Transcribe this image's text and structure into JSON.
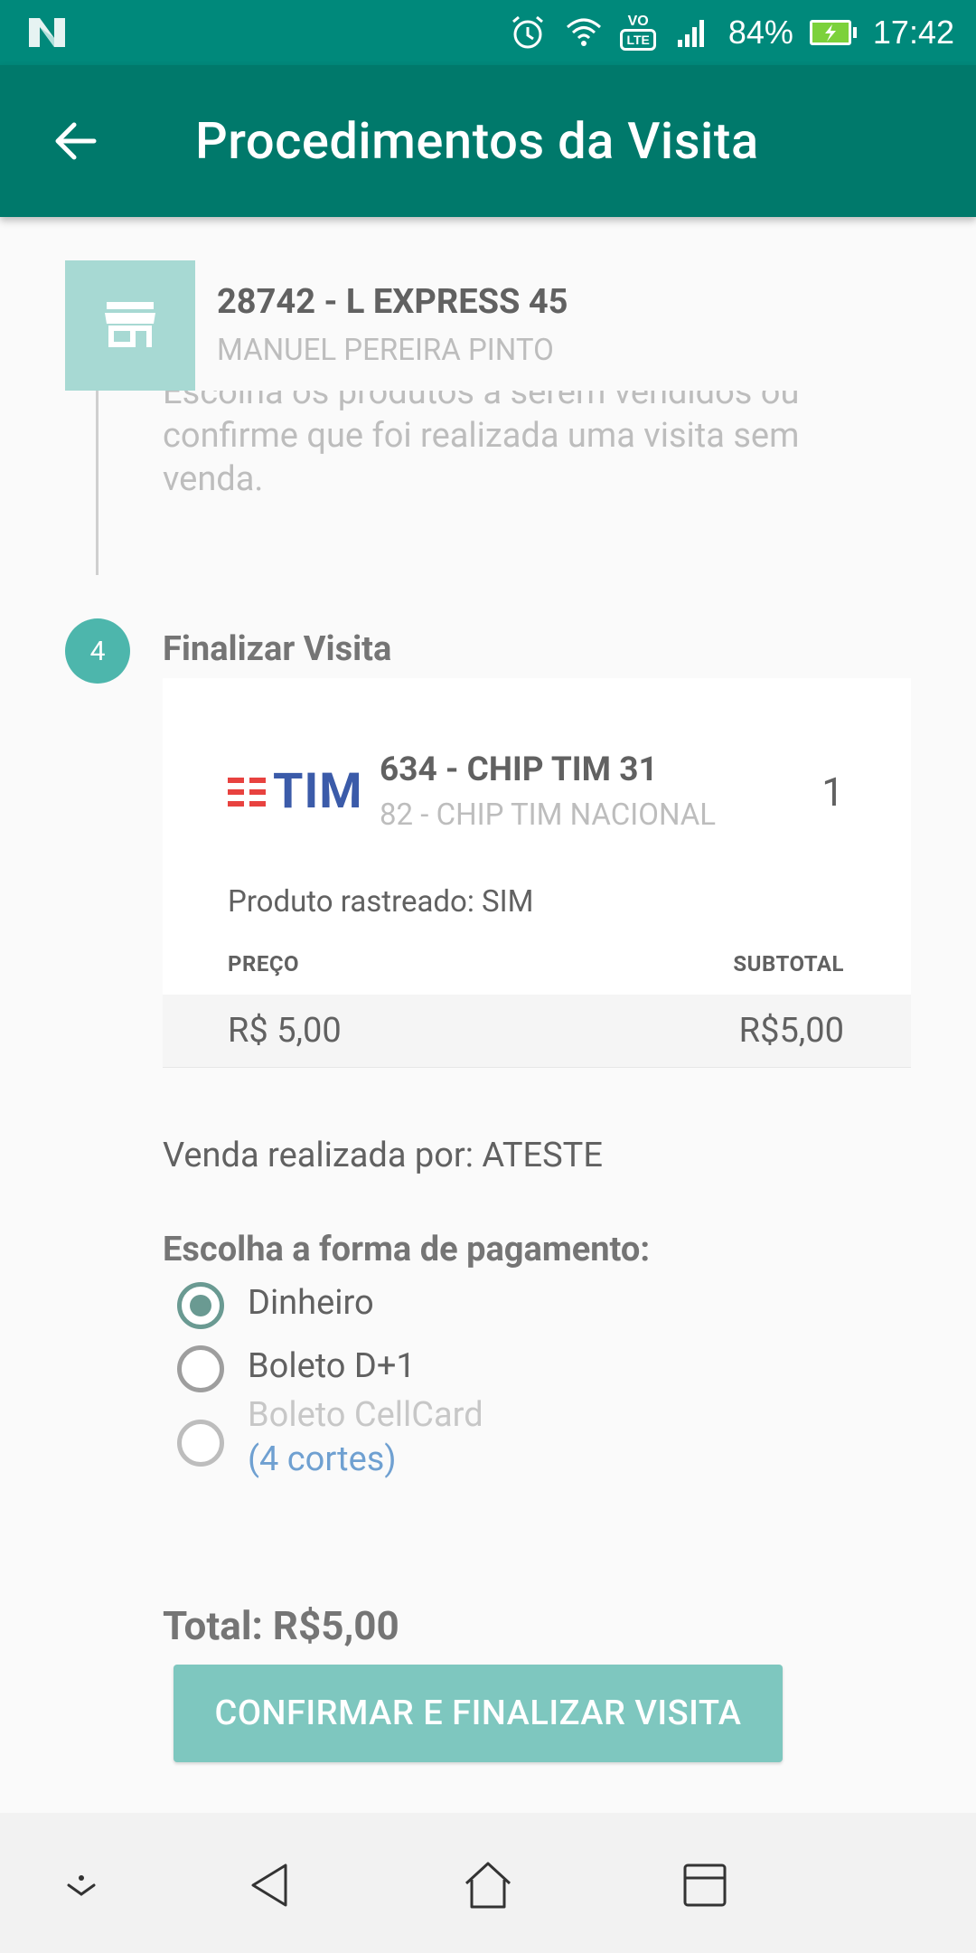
{
  "status_bar": {
    "battery": "84%",
    "time": "17:42",
    "lte_label": "VoLTE"
  },
  "app_bar": {
    "title": "Procedimentos da Visita"
  },
  "store": {
    "name": "28742 - L EXPRESS 45",
    "owner": "MANUEL PEREIRA PINTO"
  },
  "step3": {
    "description": "Escolha os produtos a serem vendidos ou confirme que foi realizada uma visita sem venda."
  },
  "step4": {
    "number": "4",
    "title": "Finalizar Visita"
  },
  "product": {
    "brand": "TIM",
    "name": "634 - CHIP TIM 31",
    "subtitle": "82 - CHIP TIM NACIONAL",
    "quantity": "1",
    "tracked": "Produto rastreado: SIM",
    "price_label": "PREÇO",
    "subtotal_label": "SUBTOTAL",
    "price": "R$ 5,00",
    "subtotal": "R$5,00"
  },
  "sold_by": "Venda realizada por: ATESTE",
  "payment": {
    "title": "Escolha a forma de pagamento:",
    "options": [
      {
        "label": "Dinheiro",
        "selected": true
      },
      {
        "label": "Boleto D+1",
        "selected": false
      },
      {
        "label": "Boleto CellCard",
        "sub": "(4 cortes)",
        "selected": false,
        "disabled": true
      }
    ]
  },
  "total": "Total: R$5,00",
  "confirm_button": "CONFIRMAR E FINALIZAR VISITA",
  "colors": {
    "primary": "#00796b",
    "status_bar": "#00897b",
    "accent": "#4db6ac",
    "button": "#7ec7bf"
  }
}
